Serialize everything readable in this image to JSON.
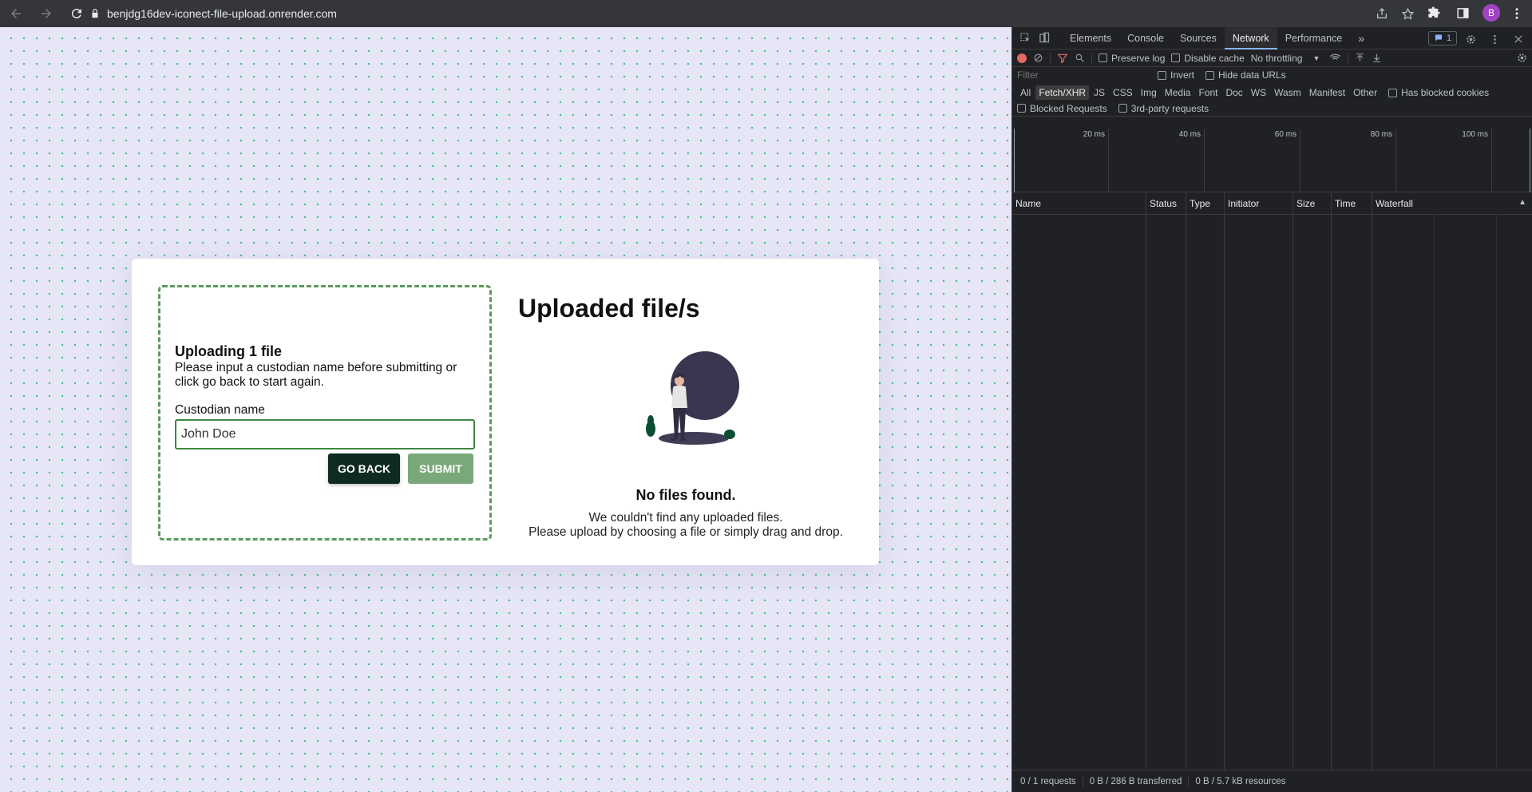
{
  "browser": {
    "url": "benjdg16dev-iconect-file-upload.onrender.com",
    "avatar_letter": "B",
    "avatar_color": "#a142c5"
  },
  "page": {
    "uploading_title": "Uploading 1 file",
    "uploading_desc": "Please input a custodian name before submitting or click go back to start again.",
    "field_label": "Custodian name",
    "custodian_value": "John Doe",
    "go_back_label": "GO BACK",
    "submit_label": "SUBMIT",
    "uploaded_title": "Uploaded file/s",
    "no_files_title": "No files found.",
    "no_files_line1": "We couldn't find any uploaded files.",
    "no_files_line2": "Please upload by choosing a file or simply drag and drop.",
    "accent_color": "#5c9a5f",
    "dark_button_color": "#0f2a20"
  },
  "devtools": {
    "tabs": [
      "Elements",
      "Console",
      "Sources",
      "Network",
      "Performance"
    ],
    "active_tab": "Network",
    "more_tabs": "»",
    "issues_count": "1",
    "toolbar": {
      "preserve_log": "Preserve log",
      "disable_cache": "Disable cache",
      "throttling": "No throttling"
    },
    "filter_placeholder": "Filter",
    "invert": "Invert",
    "hide_data_urls": "Hide data URLs",
    "types": [
      "All",
      "Fetch/XHR",
      "JS",
      "CSS",
      "Img",
      "Media",
      "Font",
      "Doc",
      "WS",
      "Wasm",
      "Manifest",
      "Other"
    ],
    "active_type": "Fetch/XHR",
    "has_blocked_cookies": "Has blocked cookies",
    "blocked_requests": "Blocked Requests",
    "third_party": "3rd-party requests",
    "timeline": [
      "20 ms",
      "40 ms",
      "60 ms",
      "80 ms",
      "100 ms"
    ],
    "columns": [
      "Name",
      "Status",
      "Type",
      "Initiator",
      "Size",
      "Time",
      "Waterfall"
    ],
    "status": {
      "requests": "0 / 1 requests",
      "transferred": "0 B / 286 B transferred",
      "resources": "0 B / 5.7 kB resources"
    }
  }
}
